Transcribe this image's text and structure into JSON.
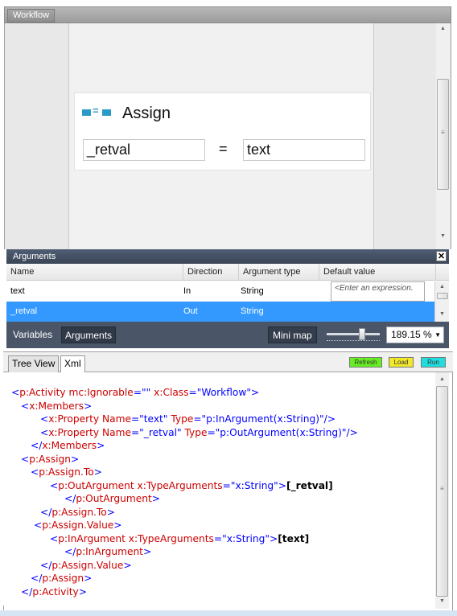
{
  "workflow": {
    "tab": "Workflow",
    "activity": {
      "title": "Assign",
      "to": "_retval",
      "op": "=",
      "value": "text"
    }
  },
  "arguments": {
    "title": "Arguments",
    "close": "✕",
    "columns": [
      "Name",
      "Direction",
      "Argument type",
      "Default value"
    ],
    "rows": [
      {
        "name": "text",
        "direction": "In",
        "type": "String",
        "default_placeholder": "<Enter an expression."
      },
      {
        "name": "_retval",
        "direction": "Out",
        "type": "String"
      }
    ],
    "footer": {
      "variables": "Variables",
      "arguments": "Arguments",
      "minimap": "Mini map",
      "zoom": "189.15 %"
    }
  },
  "bottom": {
    "tabs": [
      "Tree View",
      "Xml"
    ],
    "buttons": [
      {
        "label": "Refresh",
        "color": "#66ee22"
      },
      {
        "label": "Load",
        "color": "#f2e82a"
      },
      {
        "label": "Run",
        "color": "#22dddd"
      }
    ]
  },
  "xml": [
    [
      {
        "c": "b",
        "t": "<"
      },
      {
        "c": "t",
        "t": "p:Activity"
      },
      {
        "c": "a",
        "t": " mc:Ignorable"
      },
      {
        "c": "b",
        "t": "=\""
      },
      {
        "c": "v",
        "t": ""
      },
      {
        "c": "b",
        "t": "\""
      },
      {
        "c": "a",
        "t": " x:Class"
      },
      {
        "c": "b",
        "t": "=\""
      },
      {
        "c": "v",
        "t": "Workflow"
      },
      {
        "c": "b",
        "t": "\">"
      }
    ],
    [
      {
        "c": "b",
        "t": "<"
      },
      {
        "c": "t",
        "t": "x:Members"
      },
      {
        "c": "b",
        "t": ">"
      }
    ],
    [
      {
        "c": "b",
        "t": "<"
      },
      {
        "c": "t",
        "t": "x:Property"
      },
      {
        "c": "a",
        "t": " Name"
      },
      {
        "c": "b",
        "t": "=\""
      },
      {
        "c": "v",
        "t": "text"
      },
      {
        "c": "b",
        "t": "\""
      },
      {
        "c": "a",
        "t": " Type"
      },
      {
        "c": "b",
        "t": "=\""
      },
      {
        "c": "v",
        "t": "p:InArgument(x:String)"
      },
      {
        "c": "b",
        "t": "\"/>"
      }
    ],
    [
      {
        "c": "b",
        "t": "<"
      },
      {
        "c": "t",
        "t": "x:Property"
      },
      {
        "c": "a",
        "t": " Name"
      },
      {
        "c": "b",
        "t": "=\""
      },
      {
        "c": "v",
        "t": "_retval"
      },
      {
        "c": "b",
        "t": "\""
      },
      {
        "c": "a",
        "t": " Type"
      },
      {
        "c": "b",
        "t": "=\""
      },
      {
        "c": "v",
        "t": "p:OutArgument(x:String)"
      },
      {
        "c": "b",
        "t": "\"/>"
      }
    ],
    [
      {
        "c": "b",
        "t": "</"
      },
      {
        "c": "t",
        "t": "x:Members"
      },
      {
        "c": "b",
        "t": ">"
      }
    ],
    [
      {
        "c": "b",
        "t": "<"
      },
      {
        "c": "t",
        "t": "p:Assign"
      },
      {
        "c": "b",
        "t": ">"
      }
    ],
    [
      {
        "c": "b",
        "t": "<"
      },
      {
        "c": "t",
        "t": "p:Assign.To"
      },
      {
        "c": "b",
        "t": ">"
      }
    ],
    [
      {
        "c": "b",
        "t": "<"
      },
      {
        "c": "t",
        "t": "p:OutArgument"
      },
      {
        "c": "a",
        "t": " x:TypeArguments"
      },
      {
        "c": "b",
        "t": "=\""
      },
      {
        "c": "v",
        "t": "x:String"
      },
      {
        "c": "b",
        "t": "\">"
      },
      {
        "c": "p",
        "t": "[_retval]"
      }
    ],
    [
      {
        "c": "b",
        "t": "</"
      },
      {
        "c": "t",
        "t": "p:OutArgument"
      },
      {
        "c": "b",
        "t": ">"
      }
    ],
    [
      {
        "c": "b",
        "t": "</"
      },
      {
        "c": "t",
        "t": "p:Assign.To"
      },
      {
        "c": "b",
        "t": ">"
      }
    ],
    [
      {
        "c": "b",
        "t": "<"
      },
      {
        "c": "t",
        "t": "p:Assign.Value"
      },
      {
        "c": "b",
        "t": ">"
      }
    ],
    [
      {
        "c": "b",
        "t": "<"
      },
      {
        "c": "t",
        "t": "p:InArgument"
      },
      {
        "c": "a",
        "t": " x:TypeArguments"
      },
      {
        "c": "b",
        "t": "=\""
      },
      {
        "c": "v",
        "t": "x:String"
      },
      {
        "c": "b",
        "t": "\">"
      },
      {
        "c": "p",
        "t": "[text]"
      }
    ],
    [
      {
        "c": "b",
        "t": "</"
      },
      {
        "c": "t",
        "t": "p:InArgument"
      },
      {
        "c": "b",
        "t": ">"
      }
    ],
    [
      {
        "c": "b",
        "t": "</"
      },
      {
        "c": "t",
        "t": "p:Assign.Value"
      },
      {
        "c": "b",
        "t": ">"
      }
    ],
    [
      {
        "c": "b",
        "t": "</"
      },
      {
        "c": "t",
        "t": "p:Assign"
      },
      {
        "c": "b",
        "t": ">"
      }
    ],
    [
      {
        "c": "b",
        "t": "</"
      },
      {
        "c": "t",
        "t": "p:Activity"
      },
      {
        "c": "b",
        "t": ">"
      }
    ]
  ]
}
